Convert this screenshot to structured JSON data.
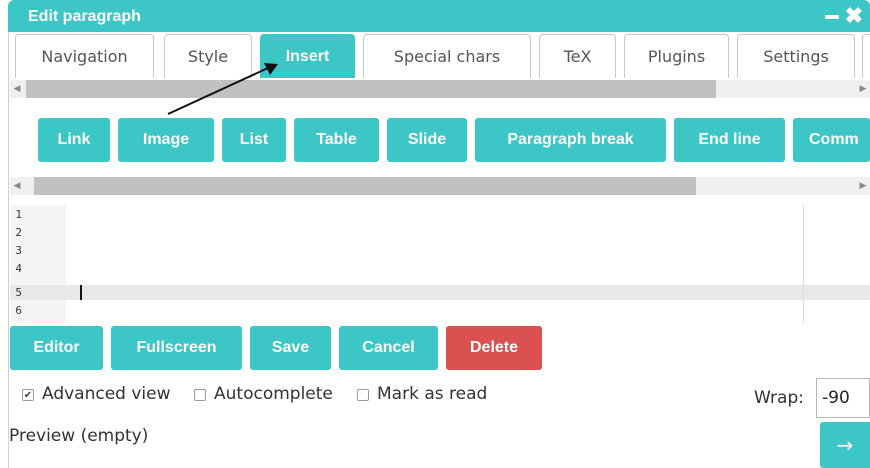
{
  "dialog": {
    "title": "Edit paragraph"
  },
  "tabs": [
    {
      "label": "Navigation",
      "active": false
    },
    {
      "label": "Style",
      "active": false
    },
    {
      "label": "Insert",
      "active": true
    },
    {
      "label": "Special chars",
      "active": false
    },
    {
      "label": "TeX",
      "active": false
    },
    {
      "label": "Plugins",
      "active": false
    },
    {
      "label": "Settings",
      "active": false
    }
  ],
  "insert_buttons": [
    "Link",
    "Image",
    "List",
    "Table",
    "Slide",
    "Paragraph break",
    "End line",
    "Comm"
  ],
  "editor": {
    "line_numbers": [
      "1",
      "2",
      "3",
      "4",
      "5",
      "6"
    ],
    "active_line": 5
  },
  "action_buttons": [
    {
      "label": "Editor",
      "color": "#3cc6c6"
    },
    {
      "label": "Fullscreen",
      "color": "#3cc6c6"
    },
    {
      "label": "Save",
      "color": "#3cc6c6"
    },
    {
      "label": "Cancel",
      "color": "#3cc6c6"
    },
    {
      "label": "Delete",
      "color": "#db5050"
    }
  ],
  "options": {
    "advanced_view": {
      "label": "Advanced view",
      "checked": true
    },
    "autocomplete": {
      "label": "Autocomplete",
      "checked": false
    },
    "mark_as_read": {
      "label": "Mark as read",
      "checked": false
    }
  },
  "wrap": {
    "label": "Wrap:",
    "value": "-90"
  },
  "preview": {
    "text": "Preview (empty)"
  },
  "icons": {
    "minimize": "minimize-icon",
    "close": "close-icon",
    "go": "arrow-right-icon"
  },
  "colors": {
    "accent": "#3cc6c6",
    "danger": "#db5050"
  }
}
